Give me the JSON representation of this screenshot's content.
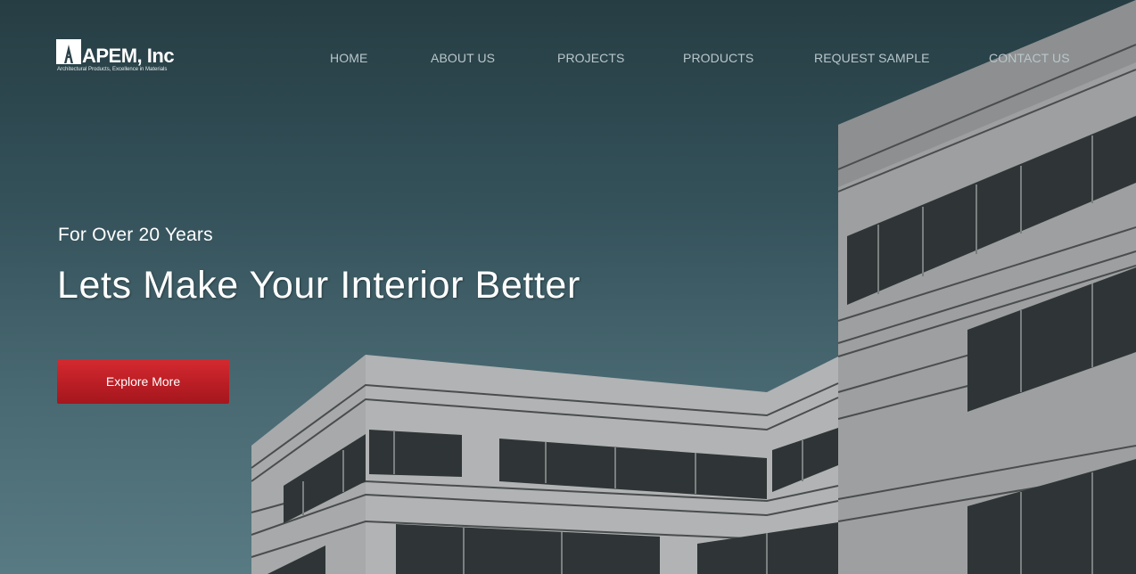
{
  "brand": {
    "name": "APEM, Inc",
    "tagline": "Architectural Products, Excellence in Materials"
  },
  "nav": {
    "items": [
      "HOME",
      "ABOUT US",
      "PROJECTS",
      "PRODUCTS",
      "REQUEST SAMPLE",
      "CONTACT US"
    ]
  },
  "hero": {
    "kicker": "For Over 20 Years",
    "headline": "Lets Make Your Interior Better",
    "cta_label": "Explore More"
  },
  "colors": {
    "accent": "#c8232a",
    "sky_top": "#263d43",
    "sky_bottom": "#587a83",
    "facade": "#a9abac",
    "window": "#2f3536"
  }
}
